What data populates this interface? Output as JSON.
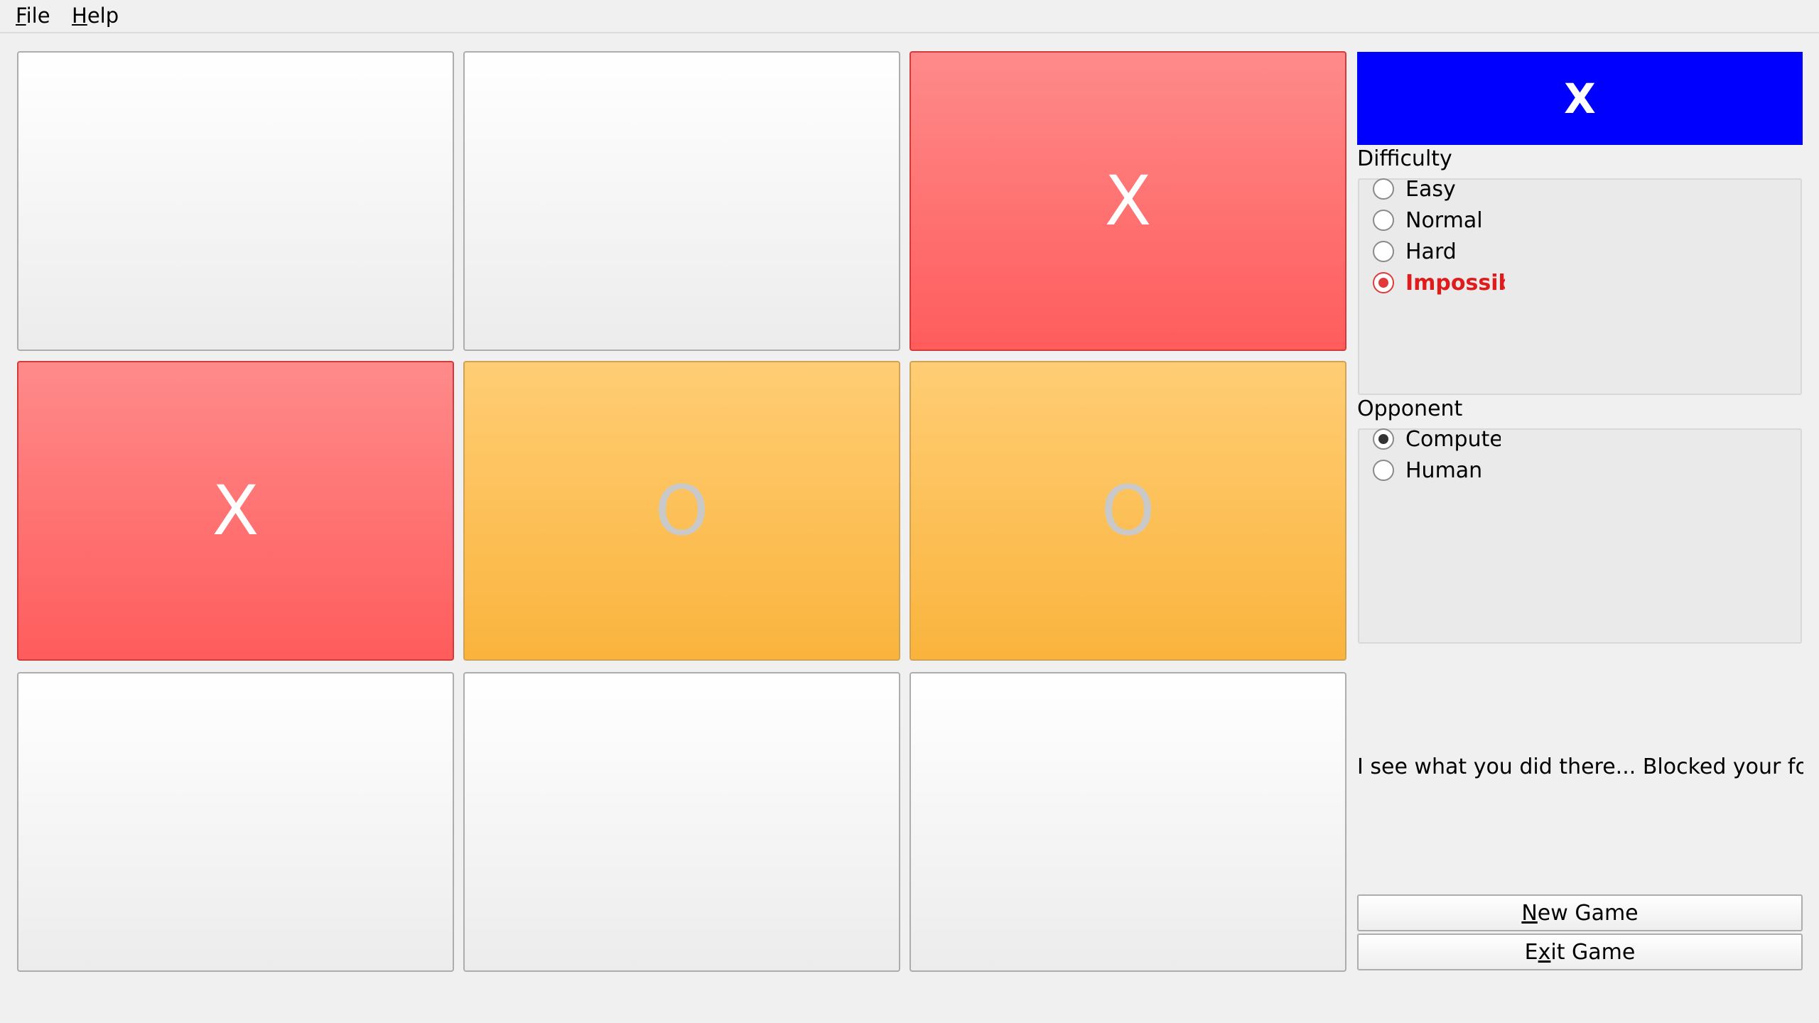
{
  "menu": {
    "file_mn": "F",
    "file_rest": "ile",
    "help_mn": "H",
    "help_rest": "elp"
  },
  "board": [
    [
      "",
      "",
      "X"
    ],
    [
      "X",
      "O",
      "O"
    ],
    [
      "",
      "",
      ""
    ]
  ],
  "turn_indicator": "X",
  "difficulty": {
    "title": "Difficulty",
    "options": [
      "Easy",
      "Normal",
      "Hard",
      "Impossibl"
    ],
    "selected": "Impossibl"
  },
  "opponent": {
    "title": "Opponent",
    "options": [
      "Computer",
      "Human"
    ],
    "selected": "Computer"
  },
  "message": "I see what you did there... Blocked your fork, lo",
  "buttons": {
    "new_game_pre": "",
    "new_game_mn": "N",
    "new_game_rest": "ew Game",
    "exit_game_pre": "E",
    "exit_game_mn": "x",
    "exit_game_rest": "it Game"
  },
  "colors": {
    "x_cell": "#ff6b6b",
    "o_cell": "#fbbf4f",
    "turn_bg": "#0000ff",
    "selected_red": "#e01b1b"
  }
}
